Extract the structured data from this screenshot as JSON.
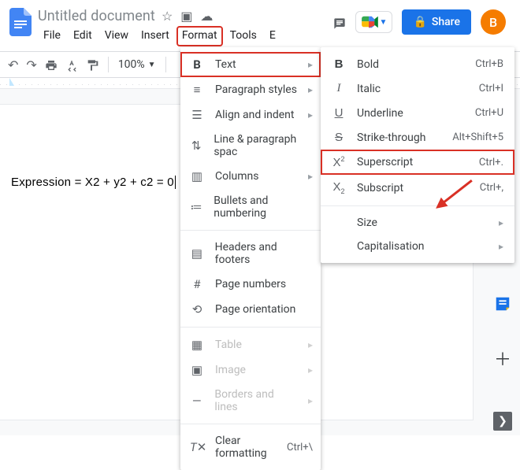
{
  "header": {
    "title": "Untitled document",
    "avatar_initial": "B",
    "share_label": "Share"
  },
  "menubar": [
    "File",
    "Edit",
    "View",
    "Insert",
    "Format",
    "Tools",
    "E"
  ],
  "toolbar": {
    "zoom": "100%"
  },
  "document": {
    "line1": "Expression = X2 + y2 + c2 = 0"
  },
  "format_menu": {
    "items": [
      {
        "icon": "B",
        "label": "Text",
        "submenu": true,
        "highlight": true
      },
      {
        "icon": "paragraph",
        "label": "Paragraph styles",
        "submenu": true
      },
      {
        "icon": "align",
        "label": "Align and indent",
        "submenu": true
      },
      {
        "icon": "linespace",
        "label": "Line & paragraph spac",
        "submenu": true
      },
      {
        "icon": "columns",
        "label": "Columns",
        "submenu": true
      },
      {
        "icon": "bullets",
        "label": "Bullets and numbering",
        "submenu": true
      }
    ],
    "group2": [
      {
        "icon": "headers",
        "label": "Headers and footers"
      },
      {
        "icon": "hash",
        "label": "Page numbers"
      },
      {
        "icon": "orient",
        "label": "Page orientation"
      }
    ],
    "group3_disabled": [
      {
        "icon": "table",
        "label": "Table",
        "submenu": true
      },
      {
        "icon": "image",
        "label": "Image",
        "submenu": true
      },
      {
        "icon": "borders",
        "label": "Borders and lines",
        "submenu": true
      }
    ],
    "clear": {
      "icon": "clear",
      "label": "Clear formatting",
      "shortcut": "Ctrl+\\"
    }
  },
  "text_submenu": {
    "items": [
      {
        "icon": "B",
        "style": "bold",
        "label": "Bold",
        "shortcut": "Ctrl+B"
      },
      {
        "icon": "I",
        "style": "italic",
        "label": "Italic",
        "shortcut": "Ctrl+I"
      },
      {
        "icon": "U",
        "style": "underline",
        "label": "Underline",
        "shortcut": "Ctrl+U"
      },
      {
        "icon": "S",
        "style": "strike",
        "label": "Strike-through",
        "shortcut": "Alt+Shift+5"
      },
      {
        "icon": "X",
        "style": "sup",
        "label": "Superscript",
        "shortcut": "Ctrl+.",
        "highlight": true
      },
      {
        "icon": "X",
        "style": "sub",
        "label": "Subscript",
        "shortcut": "Ctrl+,"
      }
    ],
    "group2": [
      {
        "label": "Size",
        "submenu": true
      },
      {
        "label": "Capitalisation",
        "submenu": true
      }
    ]
  }
}
